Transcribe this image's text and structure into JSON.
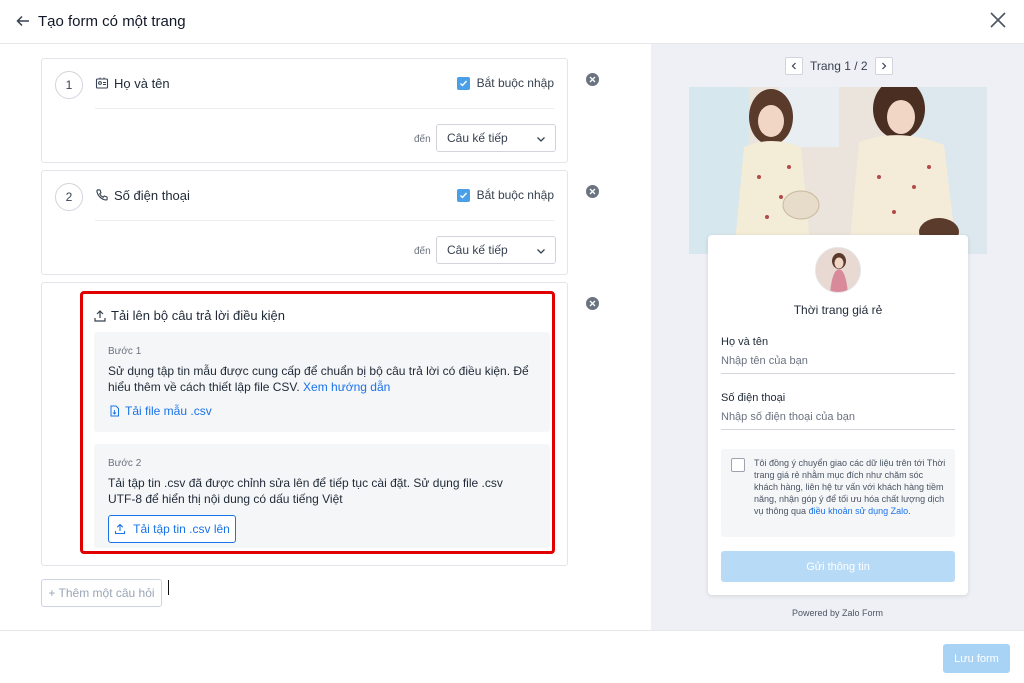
{
  "header": {
    "title": "Tạo form có một trang",
    "back_icon": "arrow-left-icon",
    "close_icon": "close-icon"
  },
  "questions": [
    {
      "number": "1",
      "icon": "id-card-icon",
      "label": "Họ và tên",
      "required_label": "Bắt buộc nhập",
      "required": true,
      "goto_label": "đến",
      "goto_value": "Câu kế tiếp"
    },
    {
      "number": "2",
      "icon": "phone-icon",
      "label": "Số điện thoại",
      "required_label": "Bắt buộc nhập",
      "required": true,
      "goto_label": "đến",
      "goto_value": "Câu kế tiếp"
    }
  ],
  "upload": {
    "title": "Tải lên bộ câu trả lời điều kiện",
    "step1": {
      "label": "Bước 1",
      "text": "Sử dụng tập tin mẫu được cung cấp để chuẩn bị bộ câu trả lời có điều kiện. Để hiểu thêm về cách thiết lập file CSV.",
      "link": "Xem hướng dẫn",
      "download": "Tải file mẫu .csv"
    },
    "step2": {
      "label": "Bước 2",
      "text": "Tải tập tin .csv đã được chỉnh sửa lên để tiếp tục cài đặt. Sử dụng file .csv UTF-8 để hiển thị nội dung có dấu tiếng Việt",
      "button": "Tải tập tin .csv lên"
    }
  },
  "add_question": "+ Thêm một câu hỏi",
  "preview": {
    "pager": "Trang 1 / 2",
    "shop_name": "Thời trang giá rẻ",
    "fields": [
      {
        "label": "Họ và tên",
        "placeholder": "Nhập tên của bạn"
      },
      {
        "label": "Số điện thoại",
        "placeholder": "Nhập số điện thoại của bạn"
      }
    ],
    "consent_text": "Tôi đồng ý chuyển giao các dữ liệu trên tới Thời trang giá rẻ nhằm mục đích như chăm sóc khách hàng, liên hệ tư vấn với khách hàng tiềm năng, nhận góp ý để tối ưu hóa chất lượng dịch vụ thông qua",
    "consent_link": "điều khoản sử dụng Zalo",
    "consent_end": ".",
    "submit": "Gửi thông tin",
    "powered_by": "Powered by Zalo Form"
  },
  "footer": {
    "save": "Lưu form"
  },
  "colors": {
    "accent": "#1a73e8",
    "highlight_border": "#e00000",
    "submit_disabled": "#b7dbf7",
    "checkbox": "#4a9fe8"
  }
}
